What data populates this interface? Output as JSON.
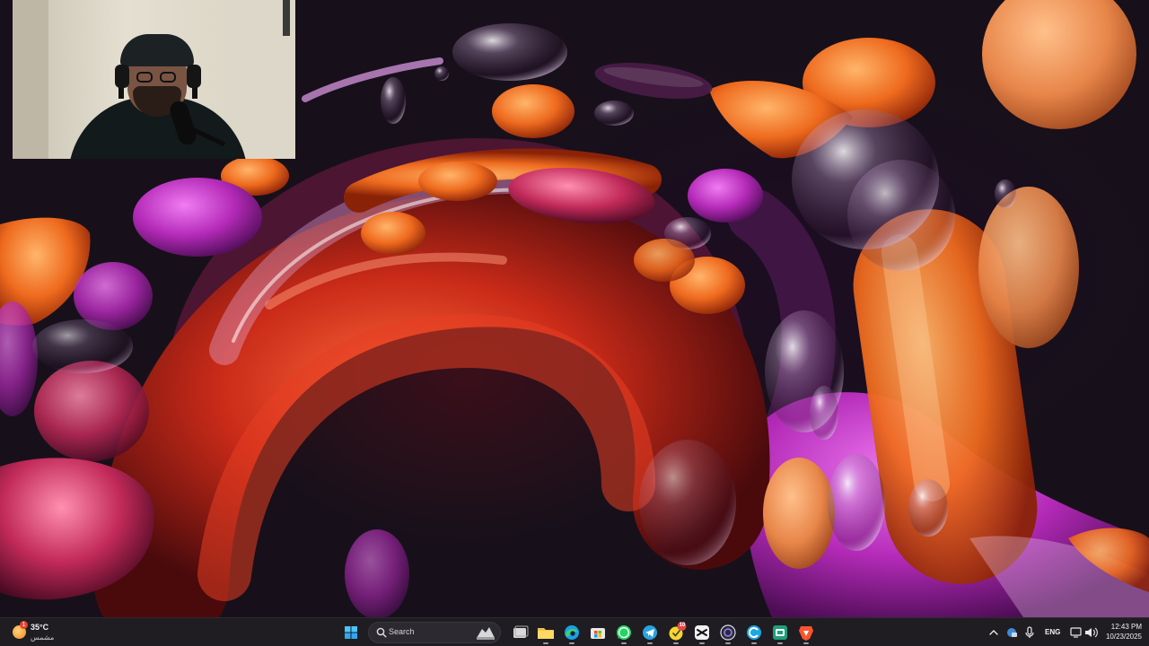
{
  "weather": {
    "temperature": "35°C",
    "condition": "مشمس",
    "badge": "1"
  },
  "taskbar": {
    "search_label": "Search",
    "apps": [
      {
        "name": "start-button",
        "icon": "windows-logo-icon"
      },
      {
        "name": "task-view",
        "icon": "task-view-icon"
      },
      {
        "name": "file-explorer",
        "icon": "folder-icon"
      },
      {
        "name": "edge",
        "icon": "edge-icon"
      },
      {
        "name": "microsoft-store",
        "icon": "store-icon"
      },
      {
        "name": "whatsapp",
        "icon": "whatsapp-icon"
      },
      {
        "name": "telegram",
        "icon": "telegram-icon"
      },
      {
        "name": "notification-app",
        "icon": "yellow-app-icon",
        "badge": "10"
      },
      {
        "name": "capcut",
        "icon": "capcut-icon"
      },
      {
        "name": "obs",
        "icon": "obs-icon"
      },
      {
        "name": "copilot",
        "icon": "copilot-icon"
      },
      {
        "name": "android-studio",
        "icon": "android-icon"
      },
      {
        "name": "brave",
        "icon": "brave-icon"
      }
    ],
    "notification_badge": "10"
  },
  "tray": {
    "language": "ENG",
    "time": "12:43 PM",
    "date": "10/23/2025"
  },
  "colors": {
    "taskbar_bg": "#1f1d22",
    "accent_blue": "#4cc2ff",
    "wallpaper_orange": "#e8621e",
    "wallpaper_magenta": "#b526b7"
  }
}
